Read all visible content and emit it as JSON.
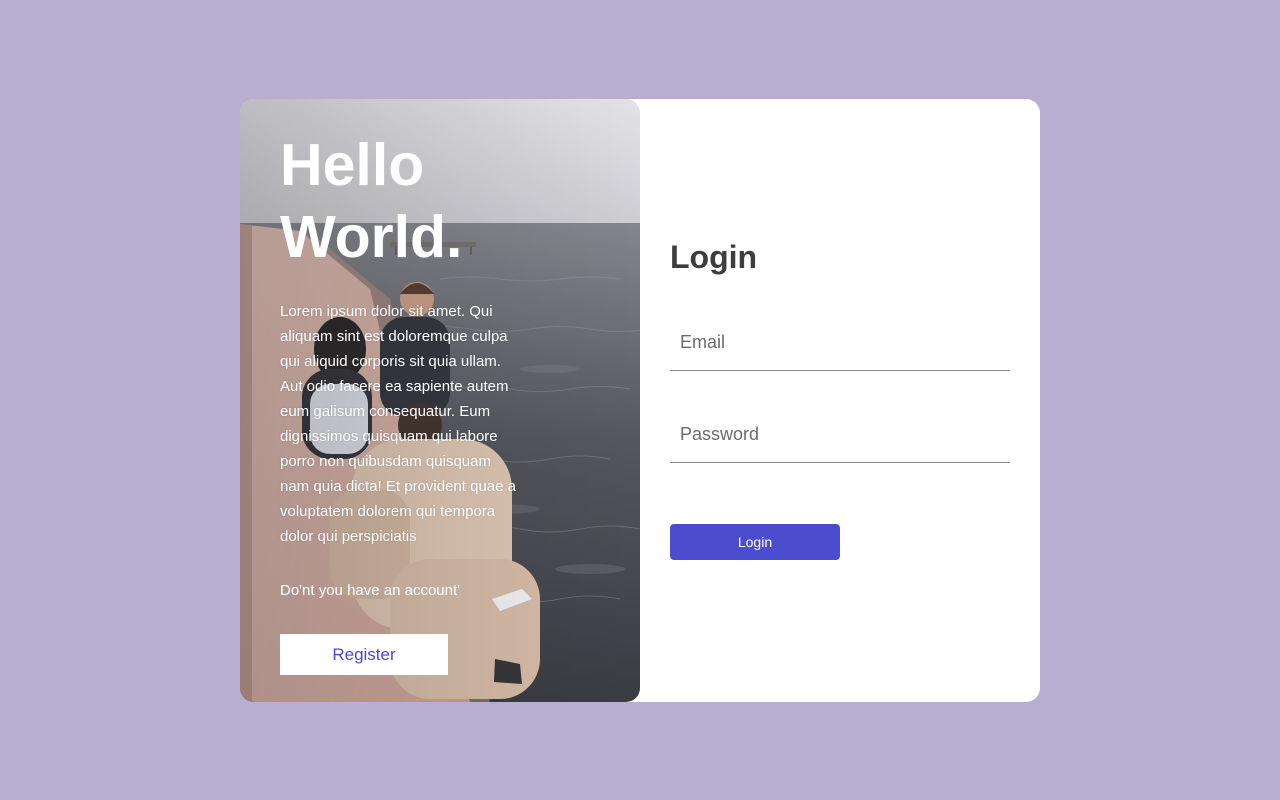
{
  "theme": {
    "page_background": "#b8aed1",
    "card_background": "#ffffff",
    "accent": "#4c4dce",
    "register_text_color": "#4a4acb"
  },
  "hero": {
    "title_line1": "Hello",
    "title_line2": "World.",
    "body": "Lorem ipsum dolor sit amet. Qui aliquam sint est doloremque culpa qui aliquid corporis sit quia ullam. Aut odio facere ea sapiente autem eum galisum consequatur. Eum dignissimos quisquam qui labore porro non quibusdam quisquam nam quia dicta! Et provident quae a voluptatem dolorem qui tempora dolor qui perspiciatis",
    "question": "Do'nt you have an account'",
    "register_label": "Register"
  },
  "login": {
    "title": "Login",
    "email_placeholder": "Email",
    "email_value": "",
    "password_placeholder": "Password",
    "password_value": "",
    "button_label": "Login"
  }
}
